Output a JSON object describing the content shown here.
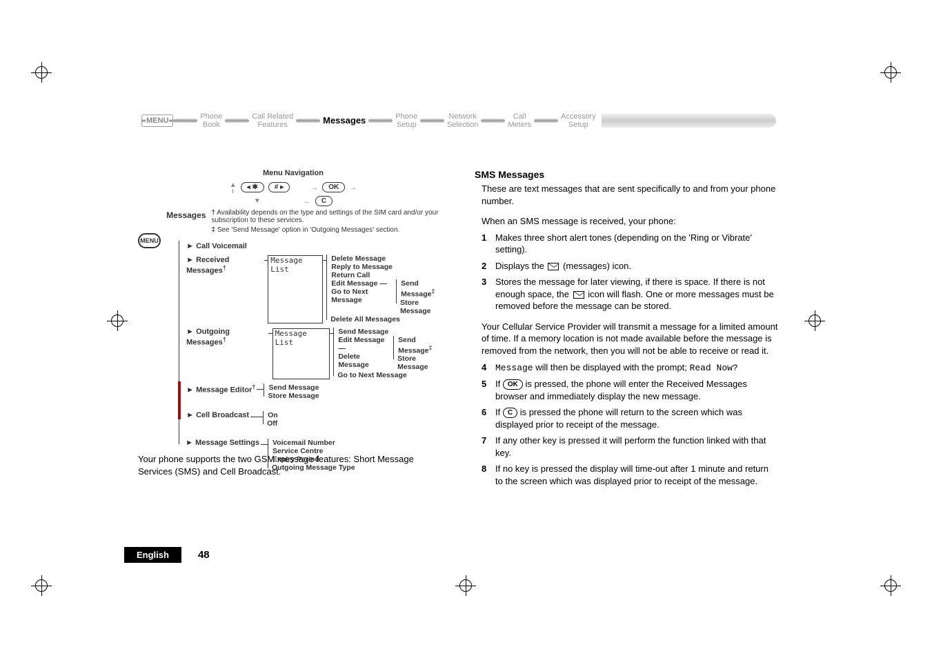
{
  "nav": {
    "menu_label": "MENU",
    "items": [
      "Phone\nBook",
      "Call Related\nFeatures",
      "Messages",
      "Phone\nSetup",
      "Network\nSelection",
      "Call\nMeters",
      "Accessory\nSetup"
    ],
    "active_index": 2
  },
  "menu_nav": {
    "title": "Menu Navigation",
    "key_left": "◂ ✱",
    "key_right": "# ▸",
    "key_ok": "OK",
    "key_c": "C"
  },
  "tree": {
    "menu_oval": "MENU",
    "root_label": "Messages",
    "footnote1": "Availability depends on the type and settings of the SIM card and/or your subscription to these services.",
    "footnote2": "See 'Send Message' option in 'Outgoing Messages' section.",
    "branches": {
      "call_voicemail": "Call Voicemail",
      "received_messages": "Received Messages",
      "received_box": "Message List",
      "received_items": [
        "Delete Message",
        "Reply to Message",
        "Return Call",
        "Edit Message",
        "Go to Next Message",
        "Delete All Messages"
      ],
      "received_sub": [
        "Send Message",
        "Store Message"
      ],
      "outgoing_messages": "Outgoing Messages",
      "outgoing_box": "Message List",
      "outgoing_items": [
        "Send Message",
        "Edit Message",
        "Delete Message",
        "Go to Next Message"
      ],
      "outgoing_sub": [
        "Send Message",
        "Store Message"
      ],
      "message_editor": "Message Editor",
      "editor_items": [
        "Send Message",
        "Store Message"
      ],
      "cell_broadcast": "Cell Broadcast",
      "cb_items": [
        "On",
        "Off"
      ],
      "message_settings": "Message Settings",
      "ms_items": [
        "Voicemail Number",
        "Service Centre",
        "Expiry Period",
        "Outgoing Message Type"
      ]
    },
    "dagger": "†",
    "ddagger": "‡"
  },
  "left_para": "Your phone supports the two GSM message features: Short Message Services (SMS) and Cell Broadcast.",
  "right": {
    "heading": "SMS Messages",
    "p1": "These are text messages that are sent specifically to and from your phone number.",
    "p2": "When an SMS message is received, your phone:",
    "list1": {
      "n1": "1",
      "t1": "Makes three short alert tones (depending on the 'Ring or Vibrate' setting).",
      "n2": "2",
      "t2a": "Displays the ",
      "t2b": " (messages) icon.",
      "n3": "3",
      "t3a": "Stores the message for later viewing, if there is space. If there is not enough space, the ",
      "t3b": " icon will flash. One or more messages must be removed before the message can be stored."
    },
    "p3": "Your Cellular Service Provider will transmit a message for a limited amount of time. If a memory location is not made available before the message is removed from the network, then you will not be able to receive or read it.",
    "list2": {
      "n4": "4",
      "t4a": "Message",
      "t4b": " will then be displayed with the prompt; ",
      "t4c": "Read Now?",
      "n5": "5",
      "t5a": "If ",
      "key5": "OK",
      "t5b": " is pressed, the phone will enter the Received Messages browser and immediately display the new message.",
      "n6": "6",
      "t6a": "If ",
      "key6": "C",
      "t6b": " is pressed the phone will return to the screen which was displayed prior to receipt of the message.",
      "n7": "7",
      "t7": "If any other key is pressed it will perform the function linked with that key.",
      "n8": "8",
      "t8": "If no key is pressed the display will time-out after 1 minute and return to the screen which was displayed prior to receipt of the message."
    }
  },
  "footer": {
    "lang": "English",
    "page": "48"
  }
}
